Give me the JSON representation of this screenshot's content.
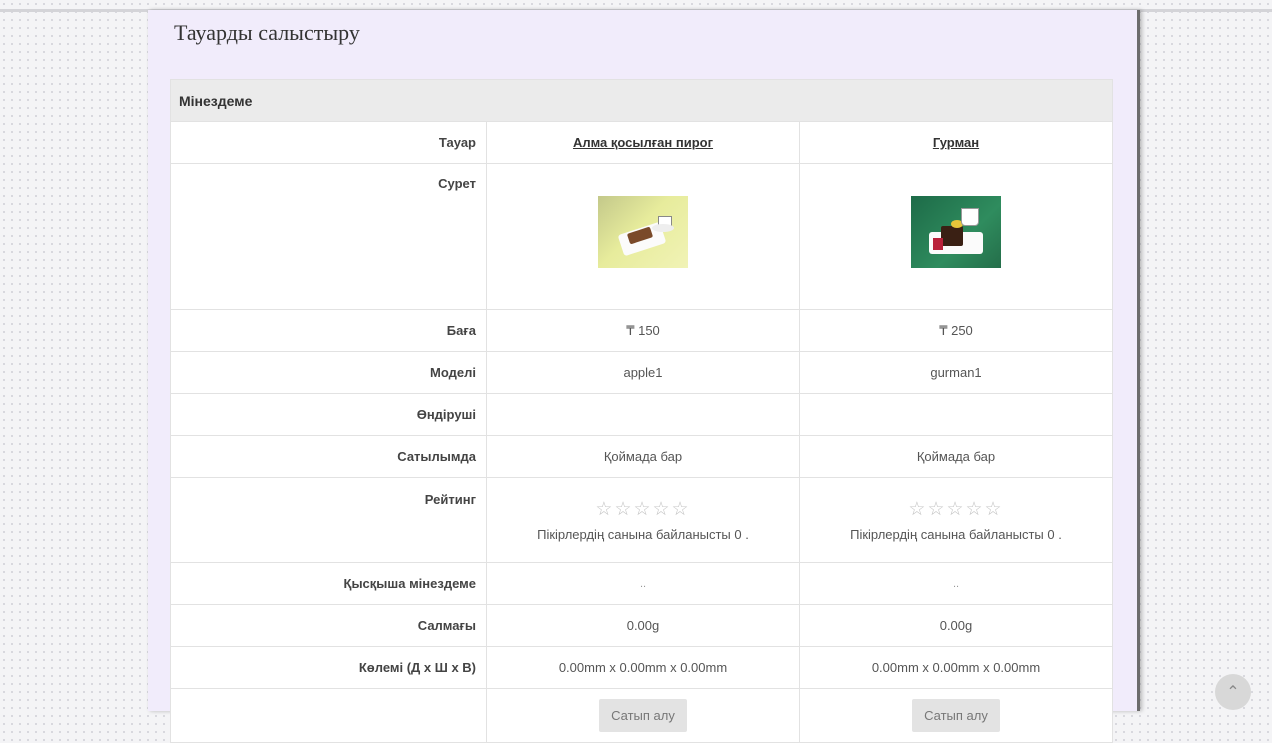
{
  "page": {
    "title": "Тауарды салыстыру"
  },
  "table": {
    "section_title": "Мінездеме",
    "labels": {
      "product": "Тауар",
      "image": "Сурет",
      "price": "Баға",
      "model": "Моделі",
      "manufacturer": "Өндіруші",
      "availability": "Сатылымда",
      "rating": "Рейтинг",
      "summary": "Қысқыша мінездеме",
      "weight": "Салмағы",
      "dimensions": "Көлемі (Д х Ш х В)"
    },
    "products": [
      {
        "name": "Алма қосылған пирог",
        "price": "₸ 150",
        "model": "apple1",
        "manufacturer": "",
        "availability": "Қоймада бар",
        "rating_stars": "☆☆☆☆☆",
        "rating_value": 0,
        "reviews": "Пікірлердің санына байланысты 0 .",
        "summary": "..",
        "weight": "0.00g",
        "dimensions": "0.00mm x 0.00mm x 0.00mm",
        "buy_label": "Сатып алу"
      },
      {
        "name": "Гурман",
        "price": "₸ 250",
        "model": "gurman1",
        "manufacturer": "",
        "availability": "Қоймада бар",
        "rating_stars": "☆☆☆☆☆",
        "rating_value": 0,
        "reviews": "Пікірлердің санына байланысты 0 .",
        "summary": "..",
        "weight": "0.00g",
        "dimensions": "0.00mm x 0.00mm x 0.00mm",
        "buy_label": "Сатып алу"
      }
    ]
  },
  "icons": {
    "scroll_top": "chevron-up-icon"
  },
  "colors": {
    "content_bg": "#f1ecfb",
    "header_bg": "#ebebeb",
    "button_bg": "#e3e3e3"
  }
}
